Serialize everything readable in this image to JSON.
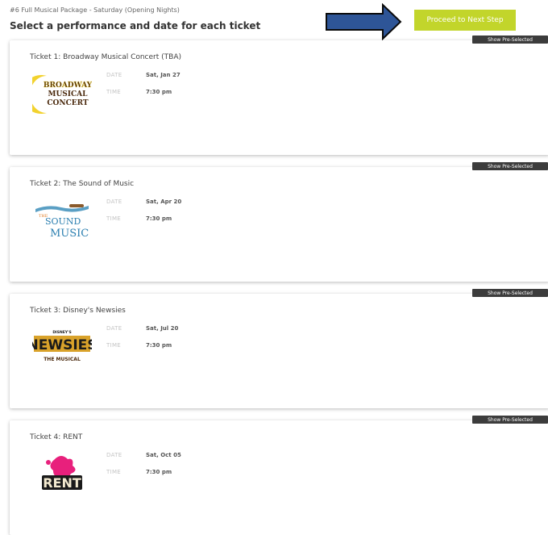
{
  "header": {
    "package_label": "#6 Full Musical Package - Saturday (Opening Nights)",
    "title": "Select a performance and date for each ticket",
    "proceed_label": "Proceed to Next Step"
  },
  "colors": {
    "proceed_button": "#c2d52b",
    "badge": "#3c3c3c",
    "arrow_fill": "#2e5597"
  },
  "tickets": [
    {
      "title": "Ticket 1: Broadway Musical Concert (TBA)",
      "badge": "Show Pre-Selected",
      "date_label": "DATE",
      "date": "Sat, Jan 27",
      "time_label": "TIME",
      "time": "7:30 pm",
      "logo_lines": [
        "BROADWAY",
        "MUSICAL",
        "CONCERT"
      ]
    },
    {
      "title": "Ticket 2: The Sound of Music",
      "badge": "Show Pre-Selected",
      "date_label": "DATE",
      "date": "Sat, Apr 20",
      "time_label": "TIME",
      "time": "7:30 pm",
      "logo_lines": [
        "THE",
        "SOUND",
        "MUSIC"
      ]
    },
    {
      "title": "Ticket 3: Disney's Newsies",
      "badge": "Show Pre-Selected",
      "date_label": "DATE",
      "date": "Sat, Jul 20",
      "time_label": "TIME",
      "time": "7:30 pm",
      "logo_lines": [
        "DISNEY'S",
        "NEWSIES",
        "THE MUSICAL"
      ]
    },
    {
      "title": "Ticket 4: RENT",
      "badge": "Show Pre-Selected",
      "date_label": "DATE",
      "date": "Sat, Oct 05",
      "time_label": "TIME",
      "time": "7:30 pm",
      "logo_lines": [
        "RENT"
      ]
    }
  ]
}
